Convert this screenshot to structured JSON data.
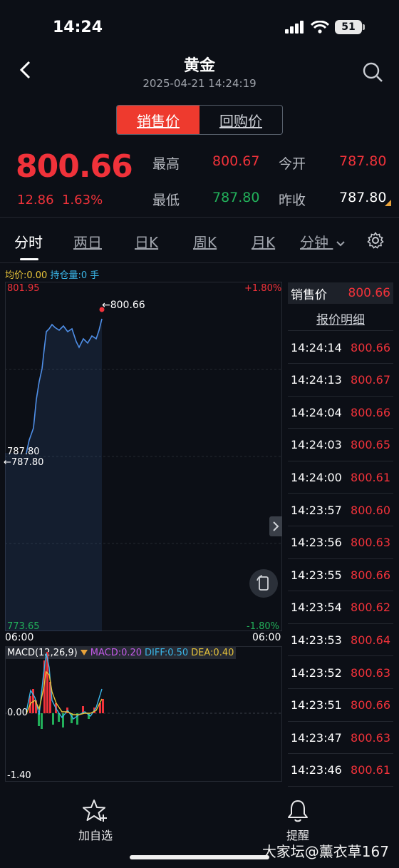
{
  "status": {
    "time": "14:24",
    "battery": "51"
  },
  "header": {
    "title": "黄金",
    "timestamp": "2025-04-21 14:24:19"
  },
  "toggle": {
    "sell": "销售价",
    "buyback": "回购价"
  },
  "quote": {
    "price": "800.66",
    "change": "12.86",
    "change_pct": "1.63%",
    "high_label": "最高",
    "high": "800.67",
    "open_label": "今开",
    "open": "787.80",
    "low_label": "最低",
    "low": "787.80",
    "prev_label": "昨收",
    "prev": "787.80"
  },
  "tabs": [
    "分时",
    "两日",
    "日K",
    "周K",
    "月K",
    "分钟"
  ],
  "info": {
    "avg": "均价:0.00",
    "hold": "持仓量:0 手"
  },
  "chart": {
    "ymax": "801.95",
    "ymax_pct": "+1.80%",
    "ymin": "773.65",
    "ymin_pct": "-1.80%",
    "base": "787.80",
    "base_arrow": "←787.80",
    "last_arrow": "←800.66",
    "x_start": "06:00",
    "x_end": "06:00"
  },
  "macd": {
    "title": "MACD(12,26,9)",
    "macd": "MACD:0.20",
    "diff": "DIFF:0.50",
    "dea": "DEA:0.40",
    "zero": "0.00",
    "min": "-1.40"
  },
  "side": {
    "label": "销售价",
    "price": "800.66",
    "detail": "报价明细",
    "rows": [
      {
        "t": "14:24:14",
        "p": "800.66"
      },
      {
        "t": "14:24:13",
        "p": "800.67"
      },
      {
        "t": "14:24:04",
        "p": "800.66"
      },
      {
        "t": "14:24:03",
        "p": "800.65"
      },
      {
        "t": "14:24:00",
        "p": "800.61"
      },
      {
        "t": "14:23:57",
        "p": "800.60"
      },
      {
        "t": "14:23:56",
        "p": "800.63"
      },
      {
        "t": "14:23:55",
        "p": "800.66"
      },
      {
        "t": "14:23:54",
        "p": "800.62"
      },
      {
        "t": "14:23:53",
        "p": "800.64"
      },
      {
        "t": "14:23:52",
        "p": "800.63"
      },
      {
        "t": "14:23:51",
        "p": "800.66"
      },
      {
        "t": "14:23:47",
        "p": "800.63"
      },
      {
        "t": "14:23:46",
        "p": "800.61"
      }
    ]
  },
  "bottom": {
    "favorite": "加自选",
    "alert": "提醒"
  },
  "watermark": "大家坛@薰衣草167",
  "colors": {
    "up": "#f0323a",
    "down": "#22b05a",
    "accent": "#ee3a2e",
    "line": "#4f8fe8"
  }
}
